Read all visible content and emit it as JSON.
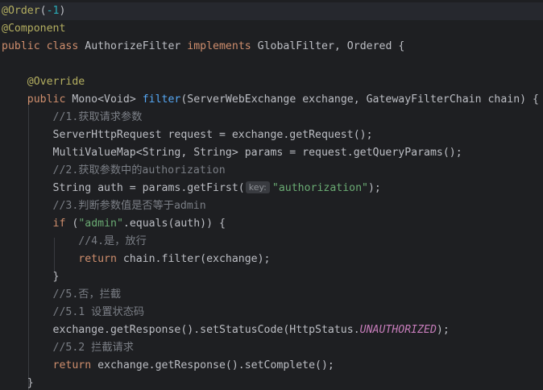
{
  "editor": {
    "l1": {
      "ann": "@Order",
      "open": "(",
      "num": "-1",
      "close": ")"
    },
    "l2": {
      "ann": "@Component"
    },
    "l3": {
      "kw1": "public",
      "kw2": "class",
      "name": "AuthorizeFilter",
      "kw3": "implements",
      "rest": "GlobalFilter, Ordered {"
    },
    "l5": {
      "ann": "@Override"
    },
    "l6": {
      "kw": "public",
      "type": "Mono<Void>",
      "fn": "filter",
      "rest": "(ServerWebExchange exchange, GatewayFilterChain chain) {"
    },
    "l7": {
      "cmt": "//1.获取请求参数"
    },
    "l8": {
      "text": "ServerHttpRequest request = exchange.getRequest();"
    },
    "l9": {
      "text": "MultiValueMap<String, String> params = request.getQueryParams();"
    },
    "l10": {
      "cmt": "//2.获取参数中的authorization"
    },
    "l11": {
      "pre": "String auth = params.getFirst(",
      "hint": "key:",
      "str": "\"authorization\"",
      "post": ");"
    },
    "l12": {
      "cmt": "//3.判断参数值是否等于admin"
    },
    "l13": {
      "kw": "if",
      "pre": " (",
      "str": "\"admin\"",
      "post": ".equals(auth)) {"
    },
    "l14": {
      "cmt": "//4.是，放行"
    },
    "l15": {
      "kw": "return",
      "post": " chain.filter(exchange);"
    },
    "l16": {
      "text": "}"
    },
    "l17": {
      "cmt": "//5.否，拦截"
    },
    "l18": {
      "cmt": "//5.1 设置状态码"
    },
    "l19": {
      "pre": "exchange.getResponse().setStatusCode(HttpStatus.",
      "const": "UNAUTHORIZED",
      "post": ");"
    },
    "l20": {
      "cmt": "//5.2 拦截请求"
    },
    "l21": {
      "kw": "return",
      "post": " exchange.getResponse().setComplete();"
    },
    "l22": {
      "text": "}"
    }
  }
}
